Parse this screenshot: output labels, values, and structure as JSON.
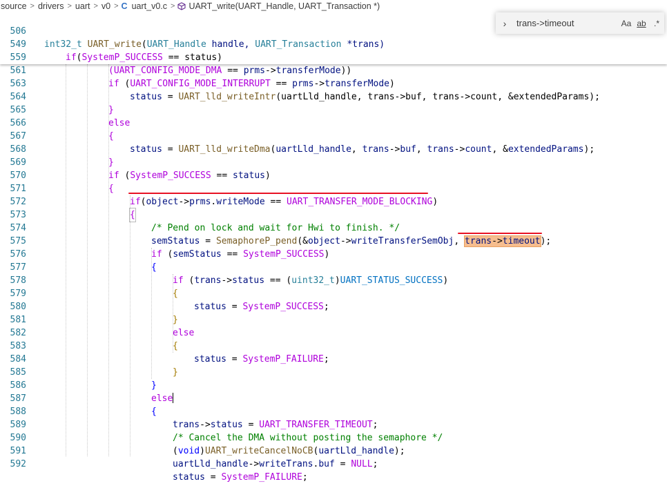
{
  "breadcrumb": {
    "items": [
      "source",
      "drivers",
      "uart",
      "v0"
    ],
    "file_name": "uart_v0.c",
    "file_icon": "C",
    "symbol": "UART_write(UART_Handle, UART_Transaction *)"
  },
  "find_widget": {
    "query": "trans->timeout",
    "match_case": "Aa",
    "whole_word": "ab",
    "regex": ".*"
  },
  "sticky_lines": [
    {
      "num": "506"
    },
    {
      "num": "549"
    },
    {
      "num": "559"
    },
    {
      "num": "561"
    }
  ],
  "lines": [
    {
      "num": "563"
    },
    {
      "num": "564"
    },
    {
      "num": "565"
    },
    {
      "num": "566"
    },
    {
      "num": "567"
    },
    {
      "num": "568"
    },
    {
      "num": "569"
    },
    {
      "num": "570"
    },
    {
      "num": "571"
    },
    {
      "num": "572"
    },
    {
      "num": "573"
    },
    {
      "num": "574"
    },
    {
      "num": "575"
    },
    {
      "num": "576"
    },
    {
      "num": "577"
    },
    {
      "num": "578"
    },
    {
      "num": "579"
    },
    {
      "num": "580"
    },
    {
      "num": "581"
    },
    {
      "num": "582"
    },
    {
      "num": "583"
    },
    {
      "num": "584"
    },
    {
      "num": "585"
    },
    {
      "num": "586"
    },
    {
      "num": "587"
    },
    {
      "num": "588"
    },
    {
      "num": "589"
    },
    {
      "num": "590"
    },
    {
      "num": "591"
    },
    {
      "num": "592"
    }
  ],
  "code": {
    "s506": {
      "t1": "int32_t",
      "t2": " ",
      "t3": "UART_write",
      "t4": "(",
      "t5": "UART_Handle",
      "t6": " handle, ",
      "t7": "UART_Transaction",
      "t8": " *trans)"
    },
    "s549": {
      "t1": "if",
      "t2": "(",
      "t3": "SystemP_SUCCESS",
      "t4": " == status)"
    },
    "s559": {
      "t1": "(UART_CONFIG_MODE_DMA",
      "t2": " == ",
      "t3": "prms",
      "t4": "->",
      "t5": "transferMode",
      "t6": "))"
    },
    "s561": {
      "t1": "if",
      "t2": " (",
      "t3": "UART_CONFIG_MODE_INTERRUPT",
      "t4": " == ",
      "t5": "prms",
      "t6": "->",
      "t7": "transferMode",
      "t8": ")"
    },
    "l563": {
      "t1": "status",
      "t2": " = ",
      "t3": "UART_lld_writeIntr",
      "t4": "(uartLld_handle, trans->buf, trans->count, &extendedParams);"
    },
    "l564": {
      "t1": "}"
    },
    "l565": {
      "t1": "else"
    },
    "l566": {
      "t1": "{"
    },
    "l567": {
      "t1": "status",
      "t2": " = ",
      "t3": "UART_lld_writeDma",
      "t4": "(",
      "t5": "uartLld_handle",
      "t6": ", ",
      "t7": "trans",
      "t8": "->",
      "t9": "buf",
      "t10": ", ",
      "t11": "trans",
      "t12": "->",
      "t13": "count",
      "t14": ", &",
      "t15": "extendedParams",
      "t16": ");"
    },
    "l568": {
      "t1": "}"
    },
    "l569": {
      "t1": "if",
      "t2": " (",
      "t3": "SystemP_SUCCESS",
      "t4": " == ",
      "t5": "status",
      "t6": ")"
    },
    "l570": {
      "t1": "{"
    },
    "l571": {
      "t1": "if",
      "t2": "(",
      "t3": "object",
      "t4": "->",
      "t5": "prms",
      "t6": ".",
      "t7": "writeMode",
      "t8": " == ",
      "t9": "UART_TRANSFER_MODE_BLOCKING",
      "t10": ")"
    },
    "l572": {
      "t1": "{"
    },
    "l573": {
      "t1": "/* Pend on lock and wait for Hwi to finish. */"
    },
    "l574": {
      "t1": "semStatus",
      "t2": " = ",
      "t3": "SemaphoreP_pend",
      "t4": "(&",
      "t5": "object",
      "t6": "->",
      "t7": "writeTransferSemObj",
      "t8": ", ",
      "t9": "trans",
      "t10": "->",
      "t11": "timeout",
      "t12": ");"
    },
    "l575": {
      "t1": "if",
      "t2": " (",
      "t3": "semStatus",
      "t4": " == ",
      "t5": "SystemP_SUCCESS",
      "t6": ")"
    },
    "l576": {
      "t1": "{"
    },
    "l577": {
      "t1": "if",
      "t2": " (",
      "t3": "trans",
      "t4": "->",
      "t5": "status",
      "t6": " == (",
      "t7": "uint32_t",
      "t8": ")",
      "t9": "UART_STATUS_SUCCESS",
      "t10": ")"
    },
    "l578": {
      "t1": "{"
    },
    "l579": {
      "t1": "status",
      "t2": " = ",
      "t3": "SystemP_SUCCESS",
      "t4": ";"
    },
    "l580": {
      "t1": "}"
    },
    "l581": {
      "t1": "else"
    },
    "l582": {
      "t1": "{"
    },
    "l583": {
      "t1": "status",
      "t2": " = ",
      "t3": "SystemP_FAILURE",
      "t4": ";"
    },
    "l584": {
      "t1": "}"
    },
    "l585": {
      "t1": "}"
    },
    "l586": {
      "t1": "else"
    },
    "l587": {
      "t1": "{"
    },
    "l588": {
      "t1": "trans",
      "t2": "->",
      "t3": "status",
      "t4": " = ",
      "t5": "UART_TRANSFER_TIMEOUT",
      "t6": ";"
    },
    "l589": {
      "t1": "/* Cancel the DMA without posting the semaphore */"
    },
    "l590": {
      "t1": "(",
      "t2": "void",
      "t3": ")",
      "t4": "UART_writeCancelNoCB",
      "t5": "(",
      "t6": "uartLld_handle",
      "t7": ");"
    },
    "l591": {
      "t1": "uartLld_handle",
      "t2": "->",
      "t3": "writeTrans",
      "t4": ".",
      "t5": "buf",
      "t6": " = ",
      "t7": "NULL",
      "t8": ";"
    },
    "l592": {
      "t1": "status",
      "t2": " = ",
      "t3": "SystemP_FAILURE",
      "t4": ";"
    }
  },
  "colors": {
    "line_number": "#237893",
    "keyword": "#0000ff",
    "control": "#af00db",
    "function": "#795e26",
    "variable": "#001080",
    "macro": "#0070c1",
    "comment": "#008000",
    "annotation_underline": "#e81123",
    "search_highlight": "#f6bd8e"
  }
}
